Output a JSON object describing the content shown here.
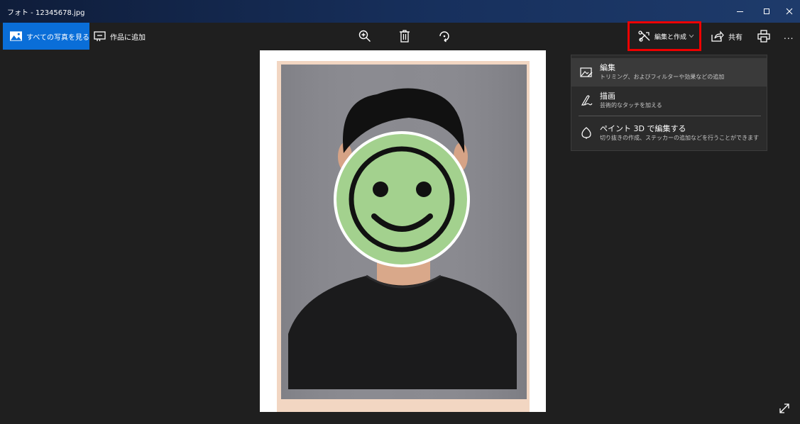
{
  "window": {
    "title": "フォト - 12345678.jpg"
  },
  "toolbar": {
    "see_all_label": "すべての写真を見る",
    "add_to_creation_label": "作品に追加",
    "edit_create_label": "編集と作成",
    "share_label": "共有",
    "more_label": "...",
    "icons": [
      "zoom-in-icon",
      "delete-icon",
      "rotate-icon",
      "print-icon"
    ]
  },
  "menu": {
    "items": [
      {
        "title": "編集",
        "description": "トリミング、およびフィルターや効果などの追加",
        "icon": "edit-image-icon"
      },
      {
        "title": "描画",
        "description": "芸術的なタッチを加える",
        "icon": "draw-icon"
      },
      {
        "title": "ペイント 3D で編集する",
        "description": "切り抜きの作成、ステッカーの追加などを行うことができます",
        "icon": "paint3d-icon"
      }
    ]
  },
  "colors": {
    "accent": "#0a6ed8",
    "highlight_box": "#ee0000",
    "background": "#1f1f1f",
    "menu_bg": "#2b2b2b",
    "smiley_face": "#a3d18e"
  }
}
